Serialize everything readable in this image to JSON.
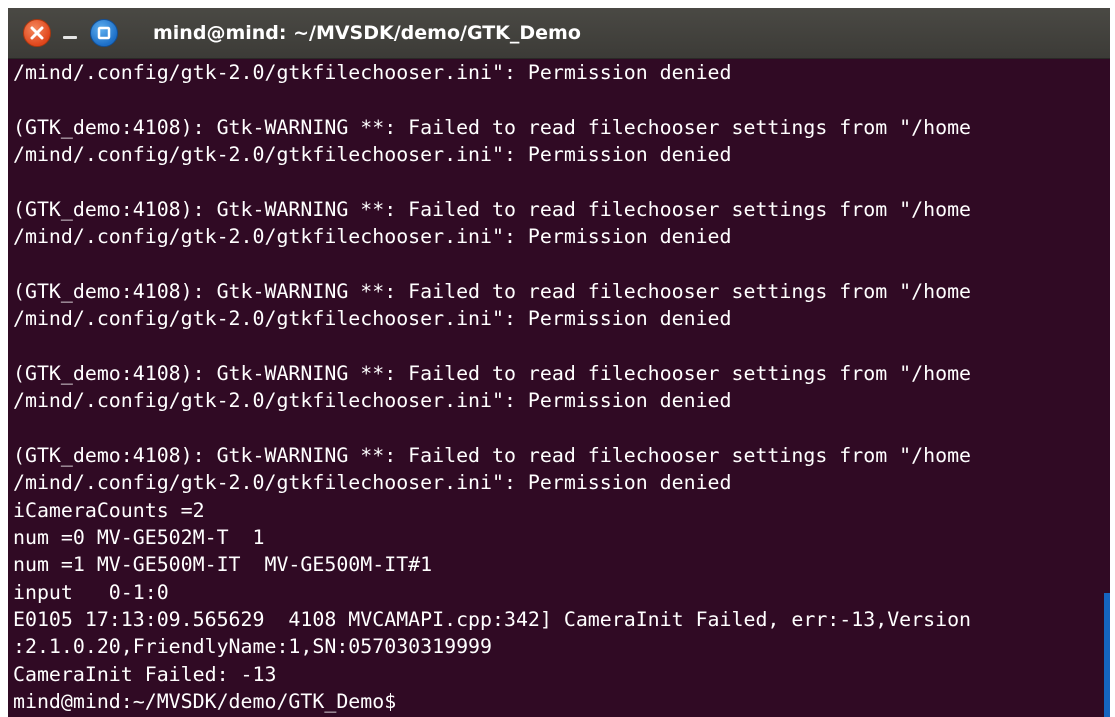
{
  "window": {
    "title": "mind@mind: ~/MVSDK/demo/GTK_Demo"
  },
  "icons": {
    "close": "close-icon",
    "minimize": "minimize-icon",
    "maximize": "maximize-icon"
  },
  "colors": {
    "terminal_bg": "#300a24",
    "titlebar_bg": "#3c3b37",
    "text": "#ffffff",
    "close_button": "#e0461c",
    "maximize_button": "#1d6fc8"
  },
  "terminal": {
    "lines": [
      "/mind/.config/gtk-2.0/gtkfilechooser.ini\": Permission denied",
      "",
      "(GTK_demo:4108): Gtk-WARNING **: Failed to read filechooser settings from \"/home",
      "/mind/.config/gtk-2.0/gtkfilechooser.ini\": Permission denied",
      "",
      "(GTK_demo:4108): Gtk-WARNING **: Failed to read filechooser settings from \"/home",
      "/mind/.config/gtk-2.0/gtkfilechooser.ini\": Permission denied",
      "",
      "(GTK_demo:4108): Gtk-WARNING **: Failed to read filechooser settings from \"/home",
      "/mind/.config/gtk-2.0/gtkfilechooser.ini\": Permission denied",
      "",
      "(GTK_demo:4108): Gtk-WARNING **: Failed to read filechooser settings from \"/home",
      "/mind/.config/gtk-2.0/gtkfilechooser.ini\": Permission denied",
      "",
      "(GTK_demo:4108): Gtk-WARNING **: Failed to read filechooser settings from \"/home",
      "/mind/.config/gtk-2.0/gtkfilechooser.ini\": Permission denied",
      "iCameraCounts =2",
      "num =0 MV-GE502M-T  1",
      "num =1 MV-GE500M-IT  MV-GE500M-IT#1",
      "input   0-1:0",
      "E0105 17:13:09.565629  4108 MVCAMAPI.cpp:342] CameraInit Failed, err:-13,Version",
      ":2.1.0.20,FriendlyName:1,SN:057030319999",
      "CameraInit Failed: -13",
      "mind@mind:~/MVSDK/demo/GTK_Demo$"
    ]
  }
}
